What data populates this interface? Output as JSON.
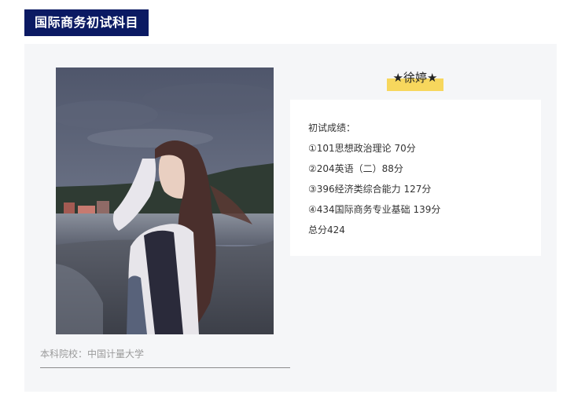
{
  "section": {
    "title": "国际商务初试科目"
  },
  "student": {
    "name": "★徐婷★",
    "undergrad": "本科院校：中国计量大学"
  },
  "scores": {
    "heading": "初试成绩：",
    "items": [
      "①101思想政治理论 70分",
      "②204英语（二）88分",
      "③396经济类综合能力 127分",
      "④434国际商务专业基础 139分"
    ],
    "total": "总分424"
  },
  "colors": {
    "title_bg": "#0b1a63",
    "name_highlight": "#f7d75d",
    "panel_bg": "#f5f6f8"
  }
}
